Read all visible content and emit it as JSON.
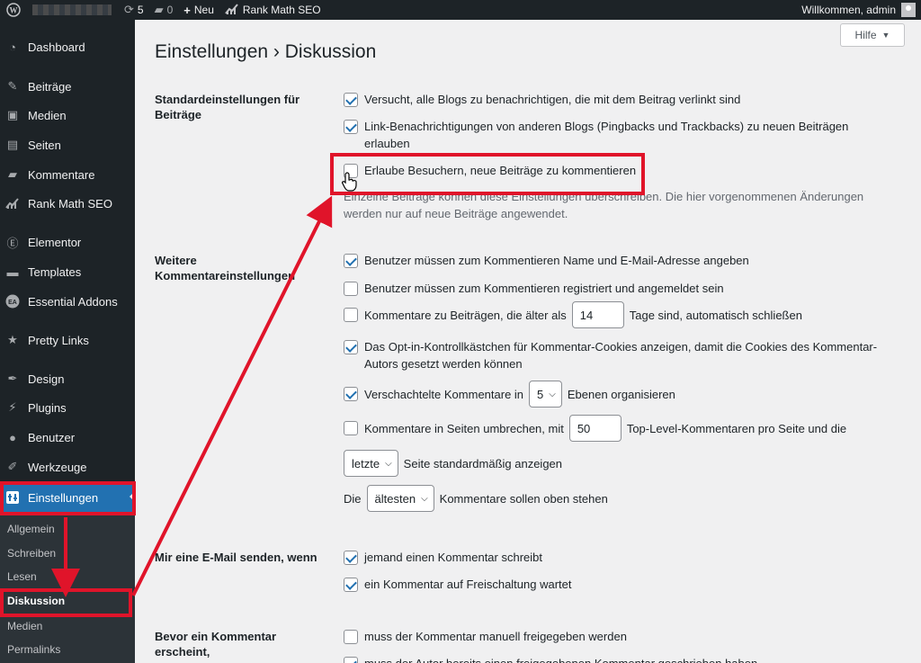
{
  "adminbar": {
    "updates_count": "5",
    "comments_count": "0",
    "new_label": "Neu",
    "plugin_label": "Rank Math SEO",
    "welcome": "Willkommen, admin"
  },
  "sidebar": {
    "items": [
      {
        "label": "Dashboard",
        "icon": "dashboard-icon"
      },
      {
        "label": "Beiträge",
        "icon": "pin-icon"
      },
      {
        "label": "Medien",
        "icon": "media-icon"
      },
      {
        "label": "Seiten",
        "icon": "pages-icon"
      },
      {
        "label": "Kommentare",
        "icon": "comments-icon"
      },
      {
        "label": "Rank Math SEO",
        "icon": "chart-icon"
      },
      {
        "label": "Elementor",
        "icon": "elementor-icon"
      },
      {
        "label": "Templates",
        "icon": "folder-icon"
      },
      {
        "label": "Essential Addons",
        "icon": "ea-icon"
      },
      {
        "label": "Pretty Links",
        "icon": "star-icon"
      },
      {
        "label": "Design",
        "icon": "brush-icon"
      },
      {
        "label": "Plugins",
        "icon": "plugin-icon"
      },
      {
        "label": "Benutzer",
        "icon": "user-icon"
      },
      {
        "label": "Werkzeuge",
        "icon": "wrench-icon"
      },
      {
        "label": "Einstellungen",
        "icon": "settings-icon"
      }
    ],
    "submenu": [
      "Allgemein",
      "Schreiben",
      "Lesen",
      "Diskussion",
      "Medien",
      "Permalinks"
    ]
  },
  "main": {
    "help_label": "Hilfe",
    "title": "Einstellungen › Diskussion",
    "section1_label": "Standardeinstellungen für Beiträge",
    "opt_blogs": "Versucht, alle Blogs zu benachrichtigen, die mit dem Beitrag verlinkt sind",
    "opt_pingbacks": "Link-Benachrichtigungen von anderen Blogs (Pingbacks und Trackbacks) zu neuen Beiträgen erlauben",
    "opt_allow_comments": "Erlaube Besuchern, neue Beiträge zu kommentieren",
    "section1_desc": "Einzelne Beiträge können diese Einstellungen überschreiben. Die hier vorgenommenen Änderungen werden nur auf neue Beiträge angewendet.",
    "section2_label": "Weitere Kommentareinstellungen",
    "opt_name_email": "Benutzer müssen zum Kommentieren Name und E-Mail-Adresse angeben",
    "opt_registered": "Benutzer müssen zum Kommentieren registriert und angemeldet sein",
    "opt_close_pre": "Kommentare zu Beiträgen, die älter als",
    "close_days": "14",
    "opt_close_post": "Tage sind, automatisch schließen",
    "opt_cookies": "Das Opt-in-Kontrollkästchen für Kommentar-Cookies anzeigen, damit die Cookies des Kommentar-Autors gesetzt werden können",
    "opt_threaded_pre": "Verschachtelte Kommentare in",
    "threaded_depth": "5",
    "opt_threaded_post": "Ebenen organisieren",
    "opt_paged_pre": "Kommentare in Seiten umbrechen, mit",
    "per_page": "50",
    "opt_paged_post": "Top-Level-Kommentaren pro Seite und die",
    "default_page": "letzte",
    "default_page_post": "Seite standardmäßig anzeigen",
    "order_pre": "Die",
    "order_value": "ältesten",
    "order_post": "Kommentare sollen oben stehen",
    "section3_label": "Mir eine E-Mail senden, wenn",
    "opt_mail_anyone": "jemand einen Kommentar schreibt",
    "opt_mail_moderation": "ein Kommentar auf Freischaltung wartet",
    "section4_label": "Bevor ein Kommentar erscheint,",
    "opt_manual": "muss der Kommentar manuell freigegeben werden",
    "opt_prev_approved": "muss der Autor bereits einen freigegebenen Kommentar geschrieben haben"
  },
  "colors": {
    "highlight": "#e0142a",
    "accent": "#2271b1",
    "sidebar_bg": "#1d2327"
  }
}
